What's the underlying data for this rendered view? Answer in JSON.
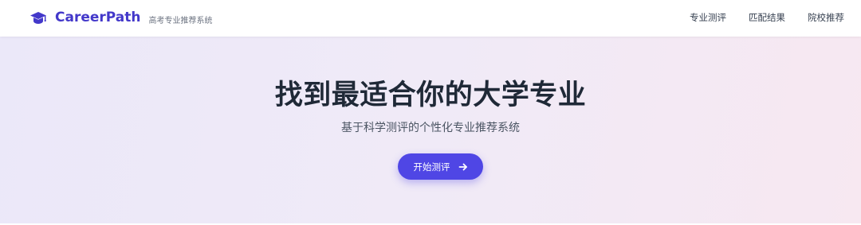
{
  "header": {
    "brand_name": "CareerPath",
    "tagline": "高考专业推荐系统",
    "logo_icon": "graduation-cap-icon",
    "nav": [
      {
        "label": "专业测评"
      },
      {
        "label": "匹配结果"
      },
      {
        "label": "院校推荐"
      }
    ]
  },
  "hero": {
    "title": "找到最适合你的大学专业",
    "subtitle": "基于科学测评的个性化专业推荐系统",
    "cta": {
      "label": "开始测评",
      "icon": "arrow-right-icon"
    }
  },
  "colors": {
    "brand": "#4338ca",
    "accent": "#4f46e5",
    "title": "#1f2937",
    "hero_gradient_start": "#ebe8f9",
    "hero_gradient_end": "#f7e8f1"
  }
}
